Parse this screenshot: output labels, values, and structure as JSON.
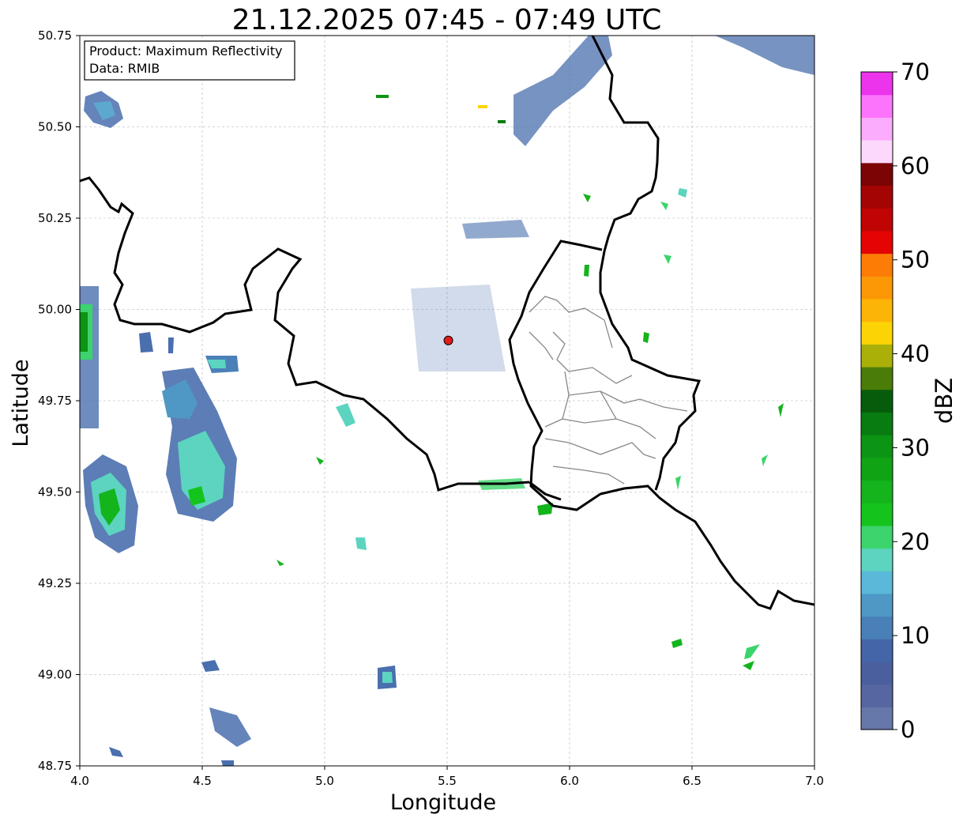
{
  "title": "21.12.2025 07:45 - 07:49 UTC",
  "info_box": {
    "product_line": "Product: Maximum Reflectivity",
    "data_line": "Data: RMIB"
  },
  "map": {
    "xlabel": "Longitude",
    "ylabel": "Latitude",
    "xlim": [
      4.0,
      7.0
    ],
    "ylim": [
      48.75,
      50.75
    ],
    "x_ticks": [
      "4.0",
      "4.5",
      "5.0",
      "5.5",
      "6.0",
      "6.5",
      "7.0"
    ],
    "y_ticks": [
      "48.75",
      "49.00",
      "49.25",
      "49.50",
      "49.75",
      "50.00",
      "50.25",
      "50.50",
      "50.75"
    ],
    "grid": true,
    "radar_site": {
      "lon": 5.505,
      "lat": 49.915,
      "color": "#e41a1c"
    }
  },
  "colorbar": {
    "label": "dBZ",
    "range": [
      0,
      70
    ],
    "ticks": [
      "0",
      "10",
      "20",
      "30",
      "40",
      "50",
      "60",
      "70"
    ],
    "colors": [
      "#6677aa",
      "#5566a0",
      "#4a5f9e",
      "#4466a8",
      "#4a80b8",
      "#4f98c6",
      "#5ab8d8",
      "#5cd4c0",
      "#3cd46c",
      "#14c41c",
      "#14b41c",
      "#10a414",
      "#0c9414",
      "#087c10",
      "#065c0a",
      "#4a7c08",
      "#aab008",
      "#fcd406",
      "#fcb406",
      "#fc9806",
      "#fc7c06",
      "#e40404",
      "#c00404",
      "#a40404",
      "#7c0404",
      "#fcd8fc",
      "#fcacfc",
      "#fc74fc",
      "#ec34ec"
    ]
  }
}
